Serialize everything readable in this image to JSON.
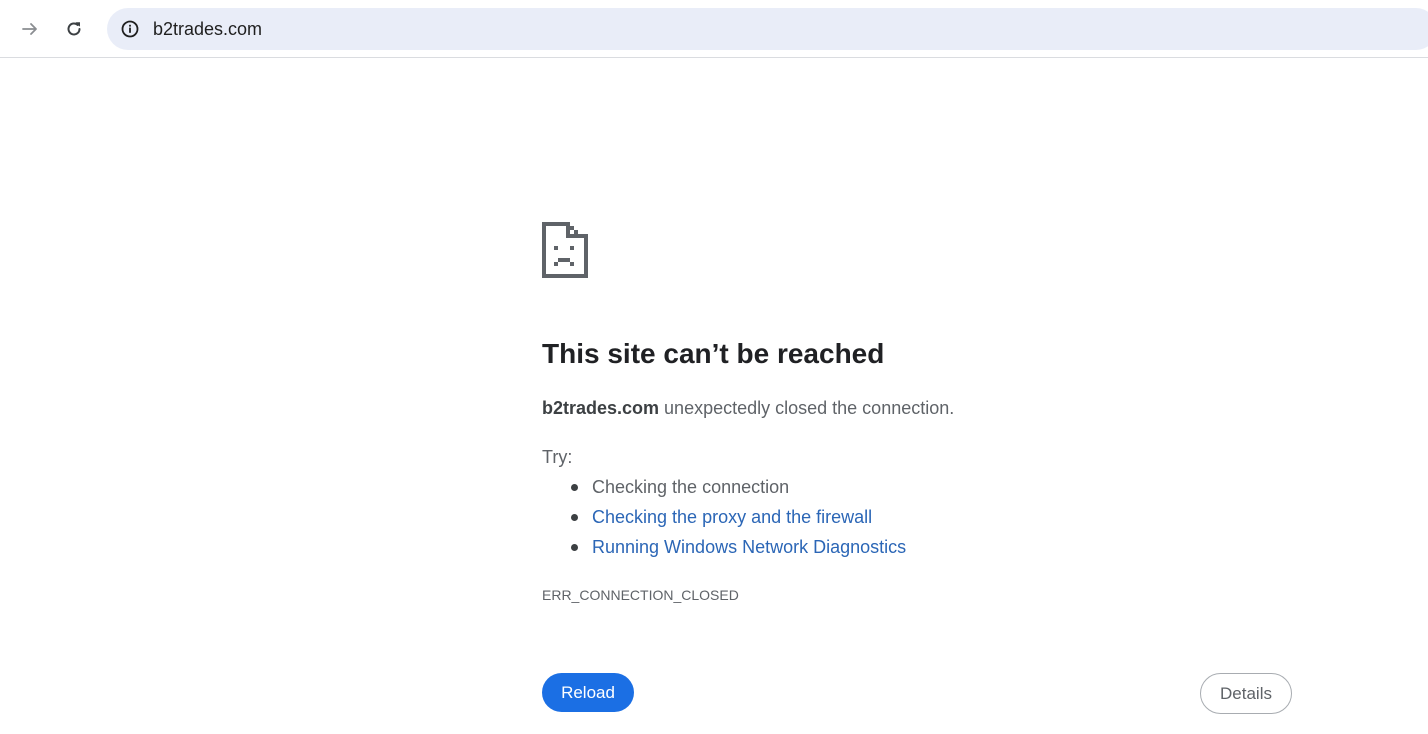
{
  "toolbar": {
    "forward_icon": "arrow-right-icon",
    "reload_icon": "reload-icon",
    "site_info_icon": "info-circle-icon",
    "url": "b2trades.com"
  },
  "error_page": {
    "icon": "sad-page-icon",
    "heading": "This site can’t be reached",
    "summary_host": "b2trades.com",
    "summary_rest": " unexpectedly closed the connection.",
    "try_label": "Try:",
    "suggestions": [
      {
        "text": "Checking the connection",
        "link": false
      },
      {
        "text": "Checking the proxy and the firewall",
        "link": true
      },
      {
        "text": "Running Windows Network Diagnostics",
        "link": true
      }
    ],
    "error_code": "ERR_CONNECTION_CLOSED",
    "reload_label": "Reload",
    "details_label": "Details"
  },
  "colors": {
    "accent": "#1b6fe4",
    "link": "#2b66b6",
    "omnibox_bg": "#e9edf8"
  }
}
